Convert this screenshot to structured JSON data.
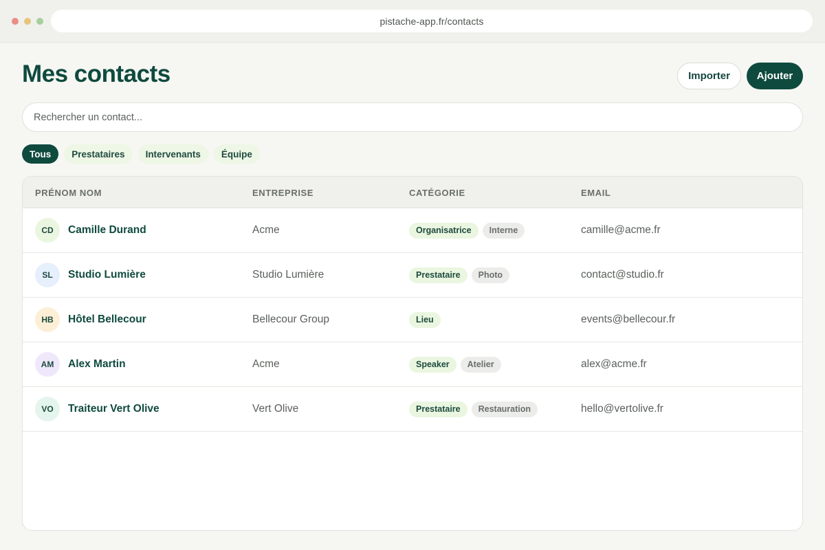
{
  "browser": {
    "url": "pistache-app.fr/contacts"
  },
  "header": {
    "title": "Mes contacts",
    "import_label": "Importer",
    "add_label": "Ajouter"
  },
  "search": {
    "placeholder": "Rechercher un contact..."
  },
  "filters": [
    {
      "label": "Tous",
      "active": true
    },
    {
      "label": "Prestataires",
      "active": false
    },
    {
      "label": "Intervenants",
      "active": false
    },
    {
      "label": "Équipe",
      "active": false
    }
  ],
  "table": {
    "columns": [
      "PRÉNOM NOM",
      "ENTREPRISE",
      "CATÉGORIE",
      "EMAIL"
    ],
    "rows": [
      {
        "initials": "CD",
        "avatar_color": "#eaf6e0",
        "name": "Camille Durand",
        "company": "Acme",
        "tags": [
          {
            "label": "Organisatrice",
            "kind": "primary"
          },
          {
            "label": "Interne",
            "kind": "secondary"
          }
        ],
        "email": "camille@acme.fr"
      },
      {
        "initials": "SL",
        "avatar_color": "#e6effc",
        "name": "Studio Lumière",
        "company": "Studio Lumière",
        "tags": [
          {
            "label": "Prestataire",
            "kind": "primary"
          },
          {
            "label": "Photo",
            "kind": "secondary"
          }
        ],
        "email": "contact@studio.fr"
      },
      {
        "initials": "HB",
        "avatar_color": "#fcefd6",
        "name": "Hôtel Bellecour",
        "company": "Bellecour Group",
        "tags": [
          {
            "label": "Lieu",
            "kind": "primary"
          }
        ],
        "email": "events@bellecour.fr"
      },
      {
        "initials": "AM",
        "avatar_color": "#efe8fb",
        "name": "Alex Martin",
        "company": "Acme",
        "tags": [
          {
            "label": "Speaker",
            "kind": "primary"
          },
          {
            "label": "Atelier",
            "kind": "secondary"
          }
        ],
        "email": "alex@acme.fr"
      },
      {
        "initials": "VO",
        "avatar_color": "#e4f5ee",
        "name": "Traiteur Vert Olive",
        "company": "Vert Olive",
        "tags": [
          {
            "label": "Prestataire",
            "kind": "primary"
          },
          {
            "label": "Restauration",
            "kind": "secondary"
          }
        ],
        "email": "hello@vertolive.fr"
      }
    ]
  },
  "colors": {
    "brand": "#0f4a3e",
    "chip_bg": "#eef6e6",
    "background": "#f6f6f2"
  }
}
